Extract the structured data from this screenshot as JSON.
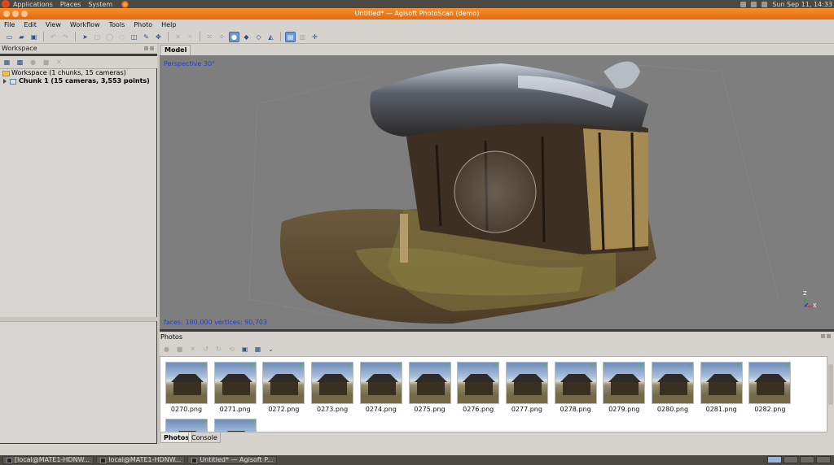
{
  "top_panel": {
    "menus": [
      "Applications",
      "Places",
      "System"
    ],
    "clock": "Sun Sep 11, 14:33"
  },
  "window": {
    "title": "Untitled* — Agisoft PhotoScan (demo)"
  },
  "menubar": [
    "File",
    "Edit",
    "View",
    "Workflow",
    "Tools",
    "Photo",
    "Help"
  ],
  "workspace": {
    "title": "Workspace",
    "root": "Workspace (1 chunks, 15 cameras)",
    "chunk": "Chunk 1 (15 cameras, 3,553 points)"
  },
  "model": {
    "tab": "Model",
    "projection": "Perspective 30°",
    "stats": "faces: 180,000 vertices: 90,703",
    "axis_z": "Z",
    "axis_x": "X"
  },
  "photos": {
    "title": "Photos",
    "items": [
      "0270.png",
      "0271.png",
      "0272.png",
      "0273.png",
      "0274.png",
      "0275.png",
      "0276.png",
      "0277.png",
      "0278.png",
      "0279.png",
      "0280.png",
      "0281.png",
      "0282.png",
      "",
      ""
    ]
  },
  "bottom_tabs": [
    "Photos",
    "Console"
  ],
  "taskbar": [
    "[local@MATE1-HDNW...",
    "local@MATE1-HDNW...",
    "Untitled* — Agisoft P..."
  ],
  "colors": {
    "title_orange": "#e2690e",
    "viewport_bg": "#7e7e7e",
    "overlay_text_blue": "#1e3fd0",
    "check_green": "#5ab43b"
  }
}
